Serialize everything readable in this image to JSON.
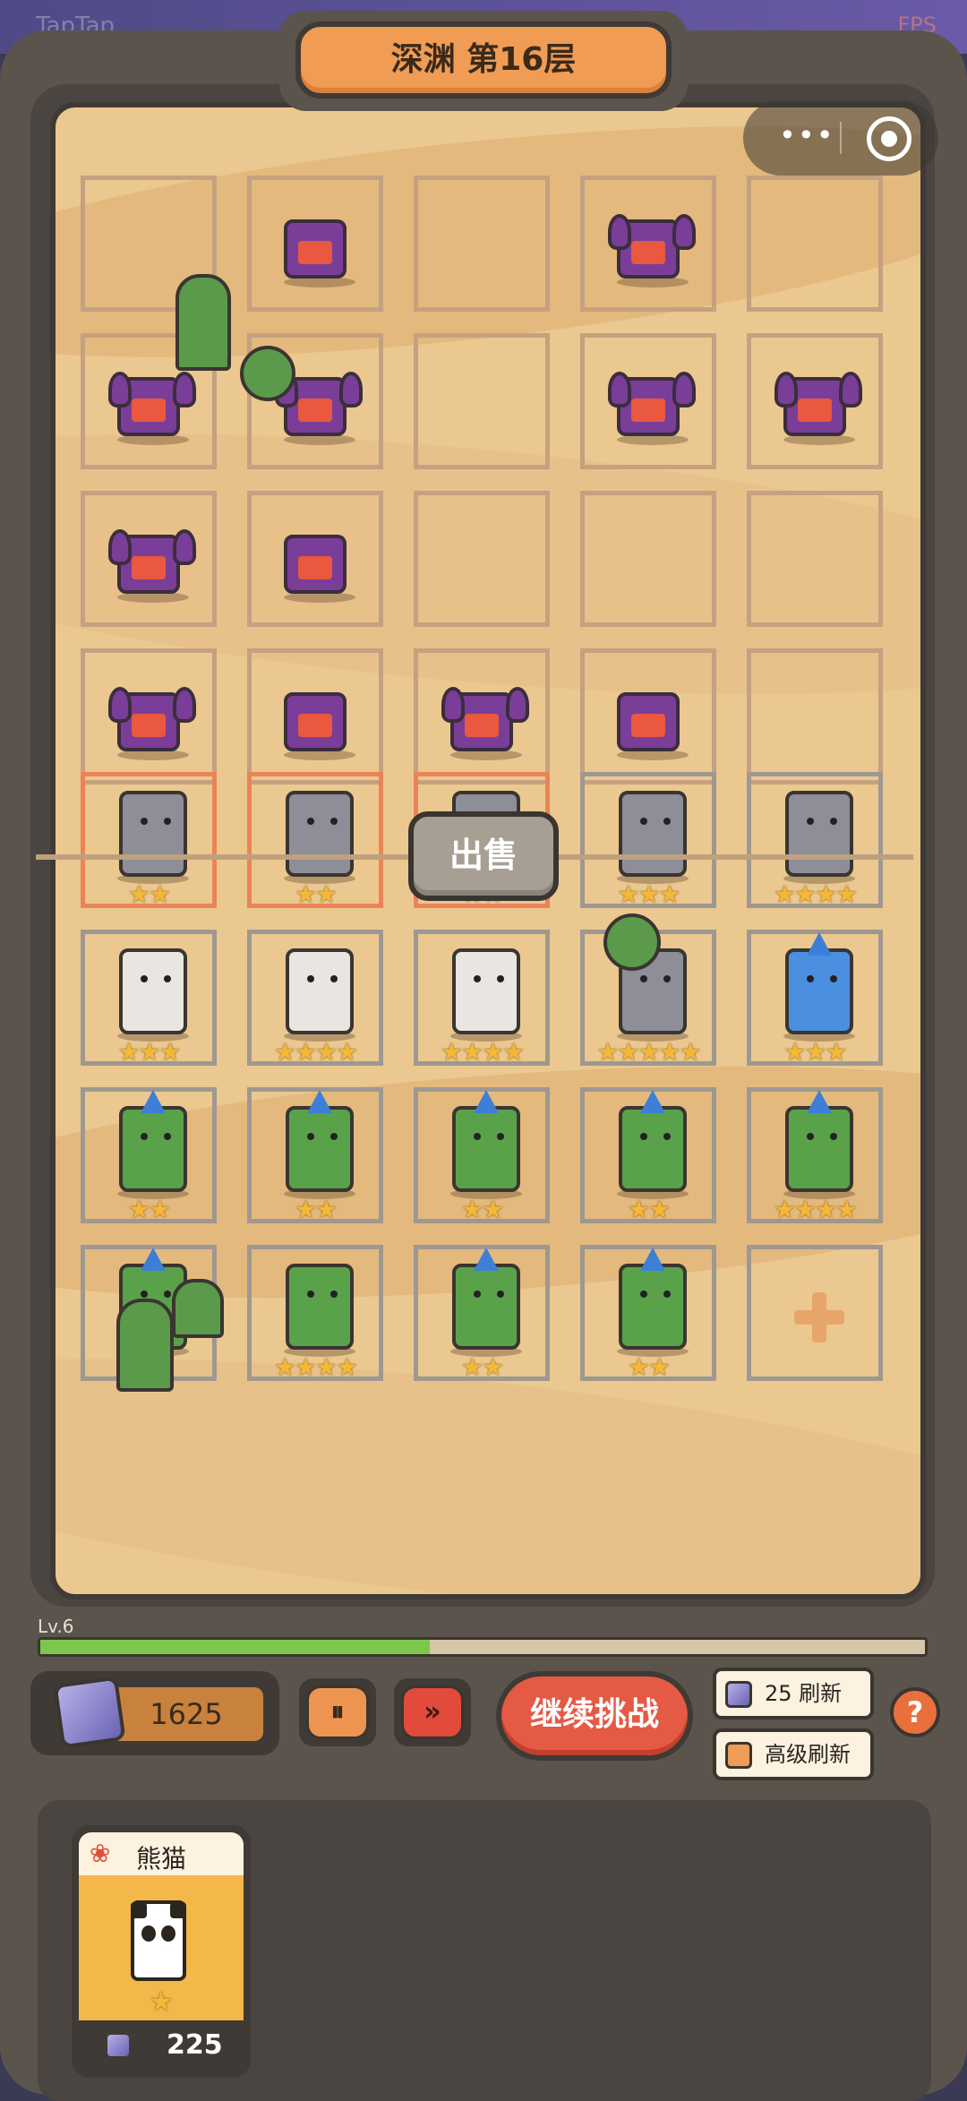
{
  "statusbar": {
    "app": "TapTap",
    "fps": "FPS"
  },
  "header": {
    "title": "深渊 第16层"
  },
  "miniprogram": {
    "more_icon": "more-dots-icon",
    "close_icon": "target-close-icon"
  },
  "enemy_grid": {
    "rows": [
      [
        "",
        "box",
        "",
        "horned",
        ""
      ],
      [
        "horned",
        "horned",
        "",
        "horned",
        "horned"
      ],
      [
        "horned",
        "box",
        "",
        "",
        ""
      ],
      [
        "horned",
        "box",
        "horned",
        "box",
        ""
      ]
    ]
  },
  "sell": {
    "label": "出售"
  },
  "player_grid": {
    "rows": [
      [
        {
          "type": "deer-elephant",
          "stars": "★★",
          "highlight": true
        },
        {
          "type": "deer-elephant",
          "stars": "★★",
          "highlight": true
        },
        {
          "type": "deer-elephant",
          "stars": "★★",
          "highlight": true
        },
        {
          "type": "deer-elephant",
          "stars": "★★★",
          "highlight": false
        },
        {
          "type": "deer-elephant",
          "stars": "★★★★",
          "highlight": false
        }
      ],
      [
        {
          "type": "leopard",
          "stars": "★★★",
          "highlight": false
        },
        {
          "type": "leopard",
          "stars": "★★★★",
          "highlight": false
        },
        {
          "type": "leopard",
          "stars": "★★★★",
          "highlight": false
        },
        {
          "type": "elephant",
          "stars": "★★★★★",
          "highlight": false
        },
        {
          "type": "shark",
          "stars": "★★★",
          "highlight": false
        }
      ],
      [
        {
          "type": "green-shark",
          "stars": "★★",
          "highlight": false
        },
        {
          "type": "green-shark",
          "stars": "★★",
          "highlight": false
        },
        {
          "type": "green-shark",
          "stars": "★★",
          "highlight": false
        },
        {
          "type": "green-shark",
          "stars": "★★",
          "highlight": false
        },
        {
          "type": "green-shark",
          "stars": "★★★★",
          "highlight": false
        }
      ],
      [
        {
          "type": "green-shark",
          "stars": "★★",
          "highlight": false
        },
        {
          "type": "green-box",
          "stars": "★★★★",
          "highlight": false
        },
        {
          "type": "green-shark",
          "stars": "★★",
          "highlight": false
        },
        {
          "type": "green-shark",
          "stars": "★★",
          "highlight": false
        },
        {
          "type": "empty",
          "stars": "",
          "highlight": false
        }
      ]
    ]
  },
  "level": {
    "label": "Lv.6",
    "progress": 0.44
  },
  "currency": {
    "amount": "1625",
    "icon": "gem-icon"
  },
  "controls": {
    "pause_label": "⏸",
    "fast_label": "»",
    "continue_label": "继续挑战",
    "refresh_label": "25 刷新",
    "adv_refresh_label": "高级刷新",
    "help_label": "?"
  },
  "shop": {
    "cards": [
      {
        "name": "熊猫",
        "star": "★",
        "cost": "225",
        "icon": "paw-icon"
      }
    ]
  },
  "colors": {
    "accent": "#f09c54",
    "red": "#e45a45",
    "sand": "#ebc890",
    "frame": "#5b544c",
    "green": "#7cc84a"
  }
}
